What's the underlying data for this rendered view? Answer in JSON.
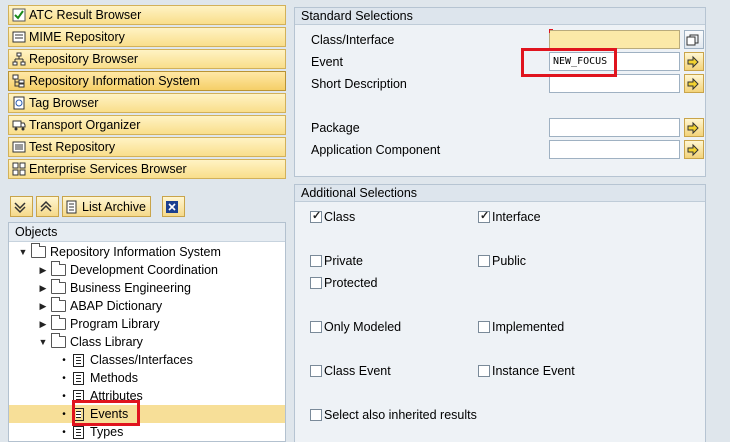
{
  "nav_buttons": [
    {
      "label": "ATC Result Browser",
      "icon": "atc-check-icon"
    },
    {
      "label": "MIME Repository",
      "icon": "mime-icon"
    },
    {
      "label": "Repository Browser",
      "icon": "hierarchy-icon"
    },
    {
      "label": "Repository Information System",
      "icon": "info-system-icon",
      "active": true
    },
    {
      "label": "Tag Browser",
      "icon": "tag-icon"
    },
    {
      "label": "Transport Organizer",
      "icon": "truck-icon"
    },
    {
      "label": "Test Repository",
      "icon": "test-icon"
    },
    {
      "label": "Enterprise Services Browser",
      "icon": "services-icon"
    }
  ],
  "toolbar": {
    "list_archive": "List Archive"
  },
  "objects": {
    "header": "Objects",
    "tree": [
      {
        "label": "Repository Information System",
        "expanded": true
      },
      {
        "label": "Development Coordination"
      },
      {
        "label": "Business Engineering"
      },
      {
        "label": "ABAP Dictionary"
      },
      {
        "label": "Program Library"
      },
      {
        "label": "Class Library",
        "expanded": true
      },
      {
        "label": "Classes/Interfaces"
      },
      {
        "label": "Methods"
      },
      {
        "label": "Attributes"
      },
      {
        "label": "Events",
        "selected": true
      },
      {
        "label": "Types"
      }
    ]
  },
  "standard": {
    "title": "Standard Selections",
    "fields": [
      {
        "label": "Class/Interface",
        "value": ""
      },
      {
        "label": "Event",
        "value": "NEW_FOCUS"
      },
      {
        "label": "Short Description",
        "value": ""
      },
      {
        "label": "Package",
        "value": ""
      },
      {
        "label": "Application Component",
        "value": ""
      }
    ]
  },
  "additional": {
    "title": "Additional Selections",
    "class": {
      "label": "Class",
      "checked": true
    },
    "interface": {
      "label": "Interface",
      "checked": true
    },
    "private": {
      "label": "Private",
      "checked": false
    },
    "public": {
      "label": "Public",
      "checked": false
    },
    "protected": {
      "label": "Protected",
      "checked": false
    },
    "only_modeled": {
      "label": "Only Modeled",
      "checked": false
    },
    "implemented": {
      "label": "Implemented",
      "checked": false
    },
    "class_event": {
      "label": "Class Event",
      "checked": false
    },
    "instance_event": {
      "label": "Instance Event",
      "checked": false
    },
    "inherited": {
      "label": "Select also inherited results",
      "checked": false
    }
  },
  "colors": {
    "highlight": "#e0141e",
    "button": "#f9de8b",
    "selected_row": "#f7df98"
  }
}
